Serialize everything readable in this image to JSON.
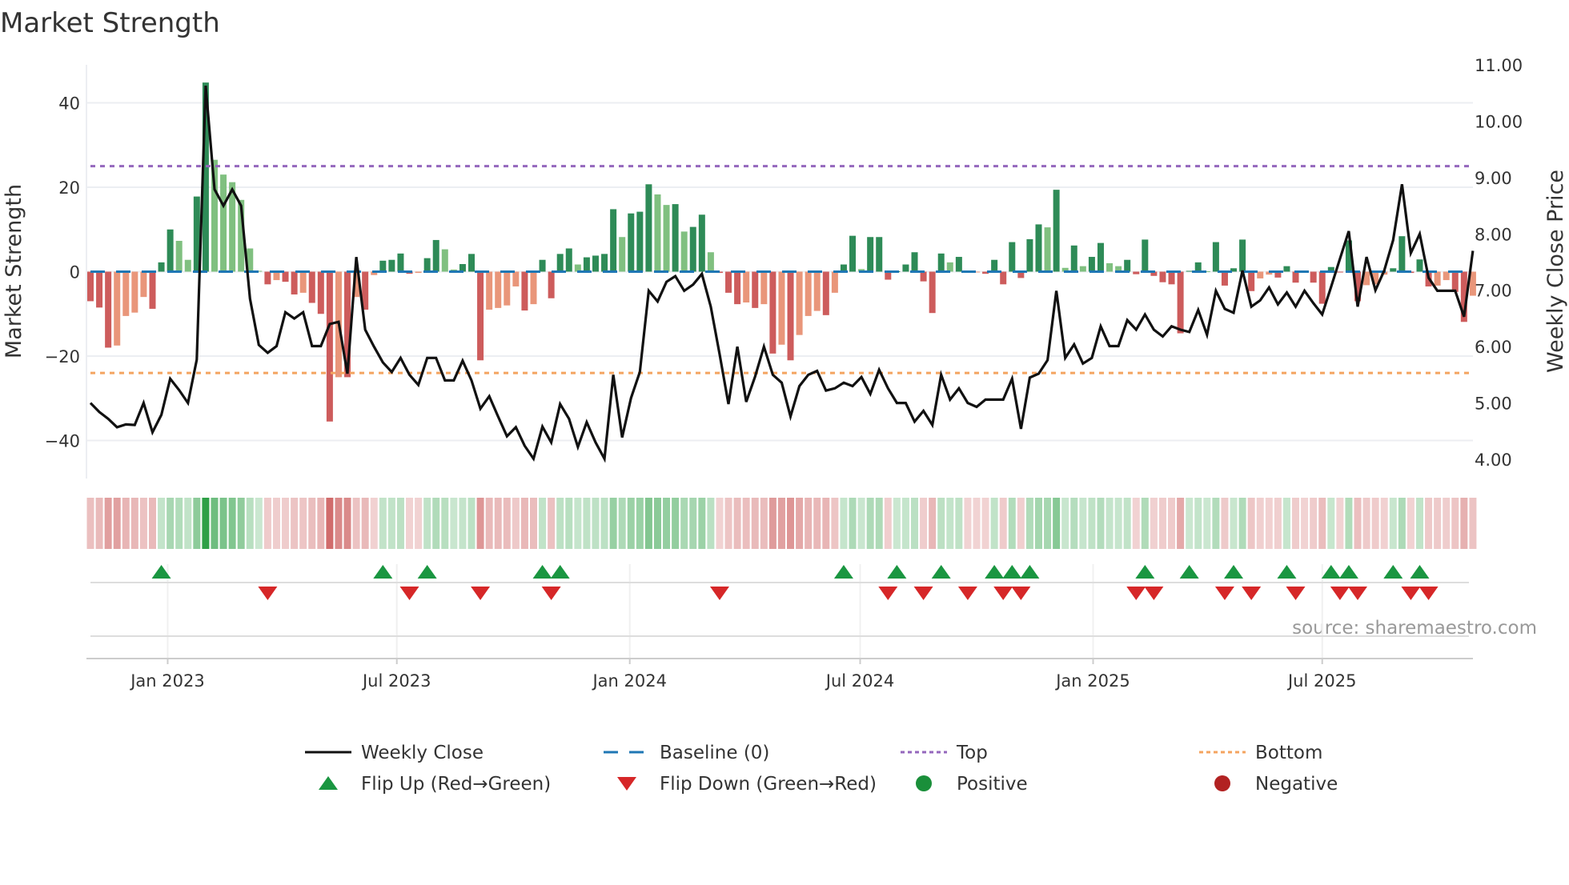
{
  "chart_data": {
    "type": "bar",
    "title": "Market Strength",
    "ylabel_left": "Market Strength",
    "ylabel_right": "Weekly Close Price",
    "source": "source: sharemaestro.com",
    "start_date": "2022-11-01",
    "interval_days": 7,
    "ylim_left": [
      -49,
      49
    ],
    "ylim_right": [
      3.66,
      11.0
    ],
    "yticks_left": [
      {
        "v": 40,
        "label": "40"
      },
      {
        "v": 20,
        "label": "20"
      },
      {
        "v": 0,
        "label": "0"
      },
      {
        "v": -20,
        "label": "−20"
      },
      {
        "v": -40,
        "label": "−40"
      }
    ],
    "yticks_right": [
      {
        "v": 11,
        "label": "11.00"
      },
      {
        "v": 10,
        "label": "10.00"
      },
      {
        "v": 9,
        "label": "9.00"
      },
      {
        "v": 8,
        "label": "8.00"
      },
      {
        "v": 7,
        "label": "7.00"
      },
      {
        "v": 6,
        "label": "6.00"
      },
      {
        "v": 5,
        "label": "5.00"
      },
      {
        "v": 4,
        "label": "4.00"
      }
    ],
    "xticks": [
      {
        "date": "2023-01-01",
        "label": "Jan 2023"
      },
      {
        "date": "2023-07-01",
        "label": "Jul 2023"
      },
      {
        "date": "2024-01-01",
        "label": "Jan 2024"
      },
      {
        "date": "2024-07-01",
        "label": "Jul 2024"
      },
      {
        "date": "2025-01-01",
        "label": "Jan 2025"
      },
      {
        "date": "2025-07-01",
        "label": "Jul 2025"
      }
    ],
    "top_level": 25,
    "bottom_level": -24,
    "baseline": 0,
    "grid": true,
    "legend_position": "bottom",
    "strength": [
      -7,
      -8.5,
      -18,
      -17.5,
      -10.5,
      -9.7,
      -6,
      -8.8,
      2.2,
      10,
      7.3,
      2.8,
      17.8,
      44.8,
      26.5,
      23,
      21.2,
      17,
      5.5,
      0.2,
      -3,
      -2,
      -2.4,
      -5.4,
      -5,
      -7.4,
      -10,
      -35.5,
      -25,
      -25,
      -6,
      -9,
      -0.8,
      2.6,
      2.8,
      4.3,
      -0.5,
      -0.3,
      3.2,
      7.5,
      5.3,
      0.5,
      1.8,
      4.2,
      -21,
      -9,
      -8.6,
      -8,
      -3.5,
      -9.2,
      -7.7,
      2.8,
      -6.3,
      4.2,
      5.5,
      1.7,
      3.4,
      3.8,
      4.2,
      14.8,
      8.2,
      13.8,
      14.2,
      20.7,
      18.3,
      15.8,
      16,
      9.5,
      10.6,
      13.5,
      4.6,
      -0.3,
      -5,
      -7.7,
      -7.3,
      -8.6,
      -7.7,
      -19.4,
      -17.3,
      -21,
      -15,
      -10.5,
      -9.3,
      -10.3,
      -5,
      1.7,
      8.5,
      0.6,
      8.2,
      8.2,
      -1.9,
      0.1,
      1.7,
      4.6,
      -2.3,
      -9.8,
      4.3,
      2.2,
      3.5,
      -0.2,
      -0.1,
      -0.5,
      2.8,
      -3,
      7,
      -1.5,
      7.7,
      11.2,
      10.5,
      19.4,
      0.9,
      6.2,
      1.3,
      3.5,
      6.8,
      2,
      1.3,
      2.8,
      -0.6,
      7.6,
      -1,
      -2.5,
      -3,
      -14.6,
      0.2,
      2.2,
      0.1,
      7,
      -3.3,
      0.8,
      7.6,
      -4.6,
      -1.6,
      -0.7,
      -1.4,
      1.3,
      -2.6,
      -0.2,
      -2.6,
      -7.6,
      1.1,
      -0.2,
      7.4,
      -7,
      -3.2,
      -3,
      -0.7,
      0.8,
      8.4,
      -0.3,
      2.9,
      -3.5,
      -3.3,
      -2,
      -4.8,
      -11.9,
      -5.7
    ],
    "close": [
      5.0,
      4.84,
      4.72,
      4.57,
      4.62,
      4.61,
      5.0,
      4.48,
      4.79,
      5.43,
      5.23,
      5.0,
      5.77,
      10.63,
      8.79,
      8.5,
      8.79,
      8.5,
      6.85,
      6.03,
      5.89,
      6.01,
      6.61,
      6.5,
      6.61,
      6.01,
      6.01,
      6.4,
      6.44,
      5.52,
      7.59,
      6.3,
      6.0,
      5.72,
      5.55,
      5.8,
      5.5,
      5.32,
      5.8,
      5.8,
      5.4,
      5.4,
      5.75,
      5.4,
      4.9,
      5.12,
      4.76,
      4.41,
      4.57,
      4.24,
      4.01,
      4.58,
      4.3,
      4.98,
      4.72,
      4.22,
      4.66,
      4.3,
      4.01,
      5.5,
      4.39,
      5.09,
      5.55,
      6.99,
      6.8,
      7.15,
      7.25,
      6.99,
      7.1,
      7.29,
      6.71,
      5.86,
      4.98,
      6.0,
      5.02,
      5.47,
      6.0,
      5.5,
      5.36,
      4.76,
      5.3,
      5.5,
      5.57,
      5.22,
      5.26,
      5.36,
      5.3,
      5.46,
      5.16,
      5.59,
      5.26,
      5.0,
      5.0,
      4.67,
      4.86,
      4.61,
      5.5,
      5.06,
      5.26,
      5.0,
      4.93,
      5.06,
      5.06,
      5.06,
      5.43,
      4.54,
      5.45,
      5.52,
      5.76,
      6.99,
      5.8,
      6.04,
      5.7,
      5.8,
      6.36,
      6.01,
      6.01,
      6.47,
      6.3,
      6.57,
      6.3,
      6.18,
      6.36,
      6.3,
      6.26,
      6.65,
      6.21,
      6.99,
      6.67,
      6.6,
      7.35,
      6.71,
      6.82,
      7.05,
      6.75,
      6.96,
      6.71,
      6.99,
      6.77,
      6.57,
      7.06,
      7.56,
      8.05,
      6.71,
      7.59,
      7.0,
      7.35,
      7.89,
      8.88,
      7.66,
      8.0,
      7.22,
      6.99,
      6.99,
      6.99,
      6.53,
      7.7
    ],
    "flip_up_index": [
      8,
      33,
      38,
      51,
      53,
      85,
      91,
      96,
      102,
      104,
      106,
      119,
      124,
      129,
      135,
      140,
      142,
      147,
      150
    ],
    "flip_down_index": [
      20,
      36,
      44,
      52,
      71,
      90,
      94,
      99,
      103,
      105,
      118,
      120,
      128,
      131,
      136,
      141,
      143,
      149,
      151
    ],
    "colors": {
      "strong_pos": "#2e8b57",
      "weak_pos": "#80c080",
      "strong_neg": "#cd5c5c",
      "weak_neg": "#e9967a",
      "close": "#111111",
      "baseline": "#1f77b4",
      "top": "#9467bd",
      "bottom": "#f4a460",
      "flip_up": "#1a9641",
      "flip_down": "#d62728",
      "positive": "#1a8f3a",
      "negative": "#b22222"
    },
    "legend": [
      {
        "key": "close",
        "label": "Weekly Close"
      },
      {
        "key": "baseline",
        "label": "Baseline (0)"
      },
      {
        "key": "top",
        "label": "Top"
      },
      {
        "key": "bottom",
        "label": "Bottom"
      },
      {
        "key": "flip_up",
        "label": "Flip Up (Red→Green)"
      },
      {
        "key": "flip_down",
        "label": "Flip Down (Green→Red)"
      },
      {
        "key": "positive",
        "label": "Positive"
      },
      {
        "key": "negative",
        "label": "Negative"
      }
    ]
  }
}
